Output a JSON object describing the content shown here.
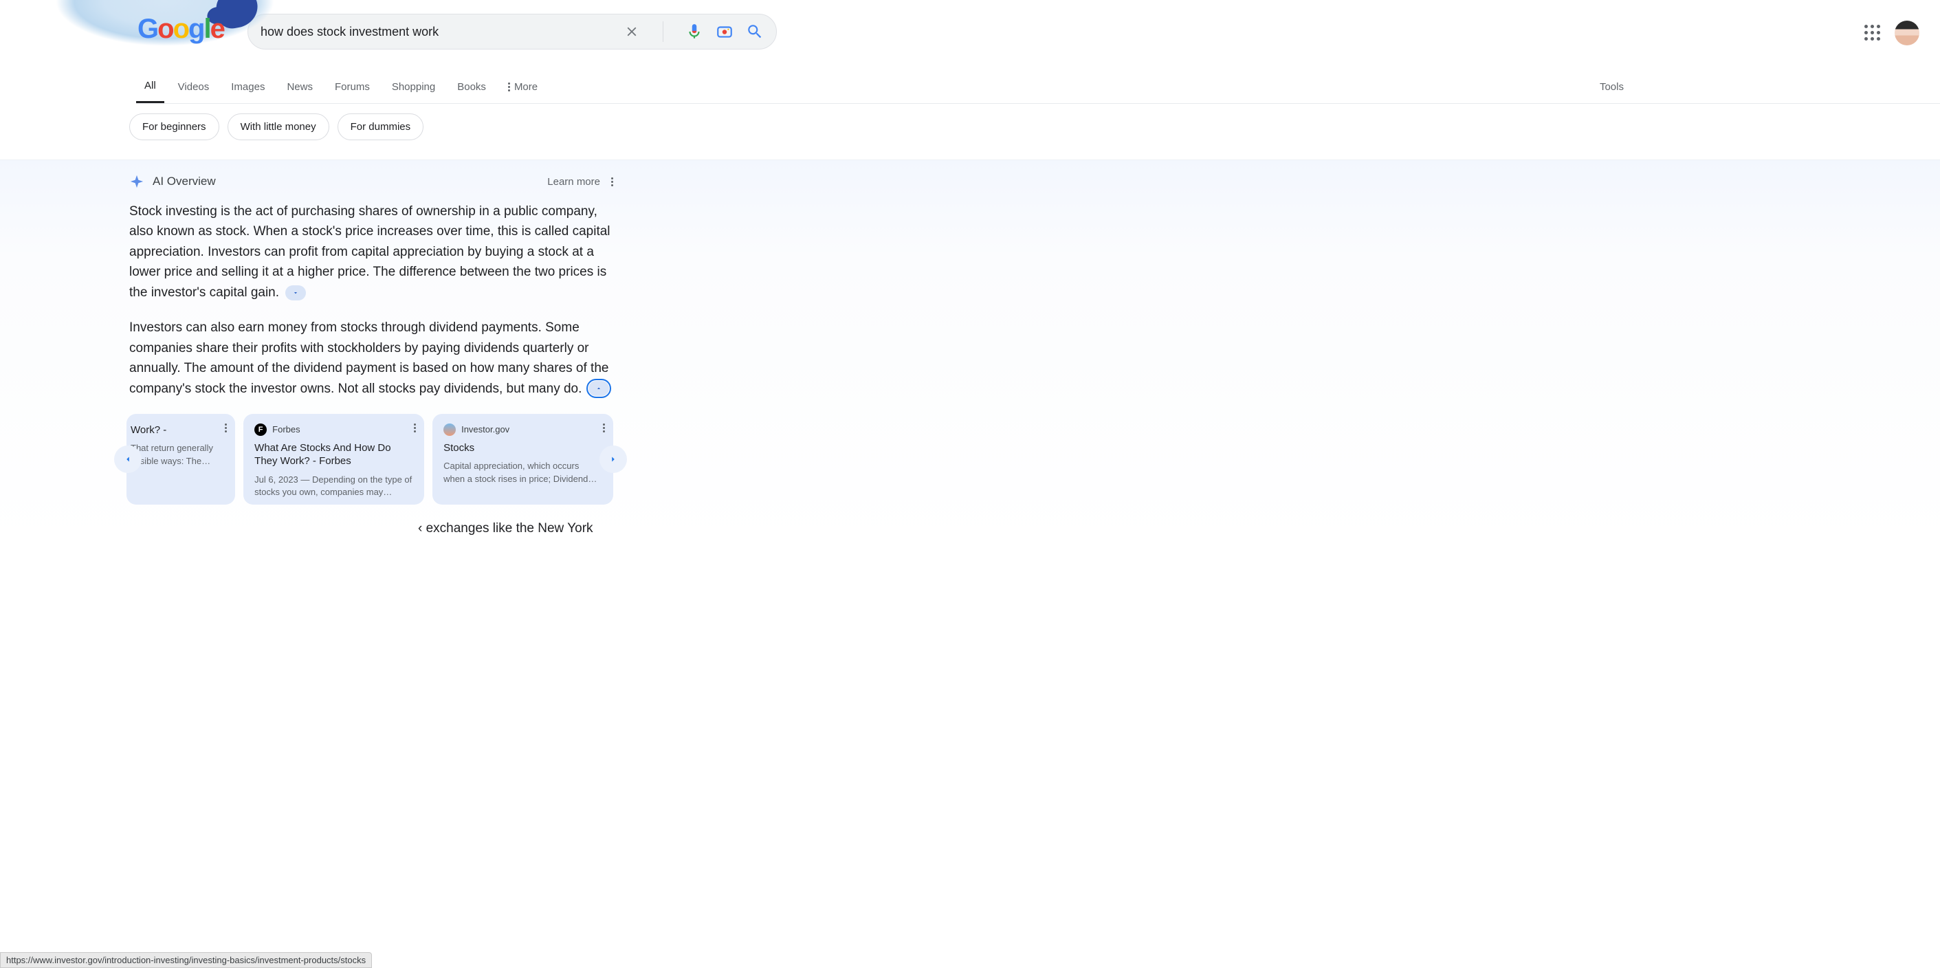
{
  "search": {
    "query": "how does stock investment work",
    "clear_label": "Clear",
    "voice_label": "Search by voice",
    "lens_label": "Search by image",
    "submit_label": "Search"
  },
  "tabs": {
    "items": [
      "All",
      "Videos",
      "Images",
      "News",
      "Forums",
      "Shopping",
      "Books"
    ],
    "more_label": "More",
    "tools_label": "Tools",
    "active_index": 0
  },
  "chips": [
    "For beginners",
    "With little money",
    "For dummies"
  ],
  "ai": {
    "title": "AI Overview",
    "learn_more": "Learn more",
    "para1": "Stock investing is the act of purchasing shares of ownership in a public company, also known as stock. When a stock's price increases over time, this is called capital appreciation. Investors can profit from capital appreciation by buying a stock at a lower price and selling it at a higher price. The difference between the two prices is the investor's capital gain.",
    "para2": "Investors can also earn money from stocks through dividend payments. Some companies share their profits with stockholders by paying dividends quarterly or annually. The amount of the dividend payment is based on how many shares of the company's stock the investor owns. Not all stocks pay dividends, but many do."
  },
  "cards": [
    {
      "site": "",
      "title": "Work? -",
      "snippet": "That return generally ossible ways: The…"
    },
    {
      "site": "Forbes",
      "title": "What Are Stocks And How Do They Work? - Forbes",
      "snippet": "Jul 6, 2023 — Depending on the type of stocks you own, companies may…"
    },
    {
      "site": "Investor.gov",
      "title": "Stocks",
      "snippet": "Capital appreciation, which occurs when a stock rises in price; Dividend…"
    }
  ],
  "cutoff_text": "‹ exchanges like the New York",
  "status_url": "https://www.investor.gov/introduction-investing/investing-basics/investment-products/stocks"
}
